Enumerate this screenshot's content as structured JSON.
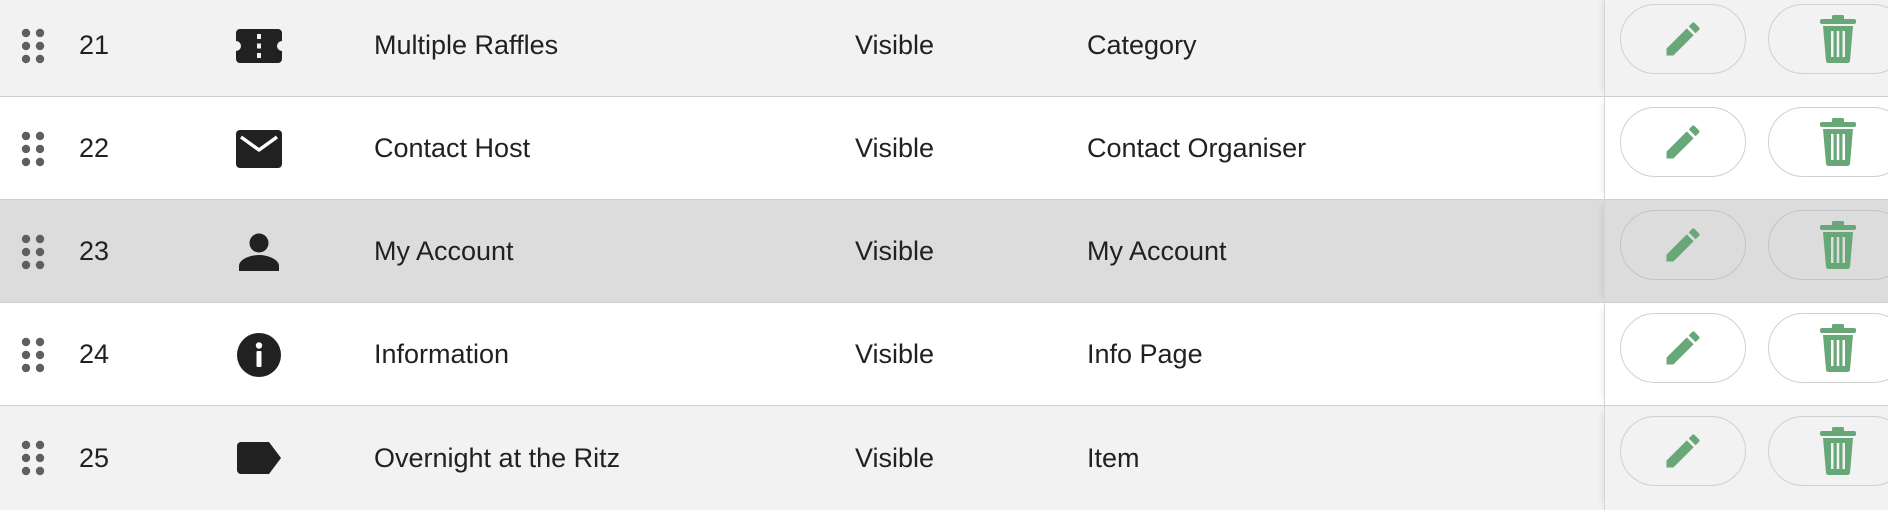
{
  "colors": {
    "action_green": "#68a878",
    "icon_dark": "#212121",
    "drag_grey": "#5f5f5f",
    "row_shade": "#f2f2f2",
    "row_hover": "#dcdcdc"
  },
  "rows": [
    {
      "num": "21",
      "icon": "ticket-icon",
      "name": "Multiple Raffles",
      "visibility": "Visible",
      "type": "Category",
      "edit_icon": "pencil-icon",
      "delete_icon": "trash-icon"
    },
    {
      "num": "22",
      "icon": "envelope-icon",
      "name": "Contact Host",
      "visibility": "Visible",
      "type": "Contact Organiser",
      "edit_icon": "pencil-icon",
      "delete_icon": "trash-icon"
    },
    {
      "num": "23",
      "icon": "person-icon",
      "name": "My Account",
      "visibility": "Visible",
      "type": "My Account",
      "edit_icon": "pencil-icon",
      "delete_icon": "trash-icon"
    },
    {
      "num": "24",
      "icon": "info-icon",
      "name": "Information",
      "visibility": "Visible",
      "type": "Info Page",
      "edit_icon": "pencil-icon",
      "delete_icon": "trash-icon"
    },
    {
      "num": "25",
      "icon": "tag-icon",
      "name": "Overnight at the Ritz",
      "visibility": "Visible",
      "type": "Item",
      "edit_icon": "pencil-icon",
      "delete_icon": "trash-icon"
    }
  ]
}
